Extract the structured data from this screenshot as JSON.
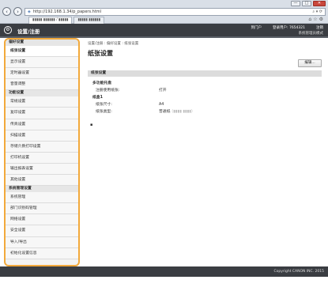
{
  "browser": {
    "url": "http://192.168.1.34/p_papers.html",
    "tabs": [
      "▮▮▮▮▮ ▮▮▮▮▮▮ / ▮▮▮▮▮",
      "▮▮▮▮▮ ▮▮▮▮▮▮"
    ],
    "controls": [
      "—",
      "□",
      "✕"
    ]
  },
  "header": {
    "title": "设置/注册",
    "top_links": [
      "到门户",
      "登录用户:",
      "7654321",
      "注销"
    ],
    "mode": "系统管理员模式"
  },
  "sidebar": {
    "sections": [
      {
        "label": "偏好设置",
        "items": [
          "纸张设置",
          "显示设置",
          "定时器设置",
          "音量调整"
        ]
      },
      {
        "label": "功能设置",
        "items": [
          "常规设置",
          "复印设置",
          "传真设置",
          "扫描设置",
          "存储介质打印设置",
          "打印机设置",
          "输出报表设置",
          "其他设置"
        ]
      },
      {
        "label": "系统管理设置",
        "items": [
          "系统管理",
          "部门识别码管理",
          "网络设置",
          "安全设置",
          "导入/导出",
          "初始化设置信息"
        ]
      }
    ],
    "active_item": "纸张设置"
  },
  "main": {
    "breadcrumb": "设置/注册 : 偏好设置 : 纸张设置",
    "title": "纸张设置",
    "edit_label": "编辑...",
    "section_title": "纸张设置",
    "group_multi": "多功能托盘",
    "multi_row_key": "注册使用纸张:",
    "multi_row_val": "打开",
    "group_drawer": "纸盒1",
    "drawer_size_key": "纸张尺寸:",
    "drawer_size_val": "A4",
    "drawer_type_key": "纸张类型:",
    "drawer_type_val": "普通纸",
    "drawer_type_extra": "(▮▮▮▮ ▮▮▮▮)",
    "bottom_mark": "▪"
  },
  "footer": {
    "copyright": "Copyright CANON INC. 2015"
  }
}
